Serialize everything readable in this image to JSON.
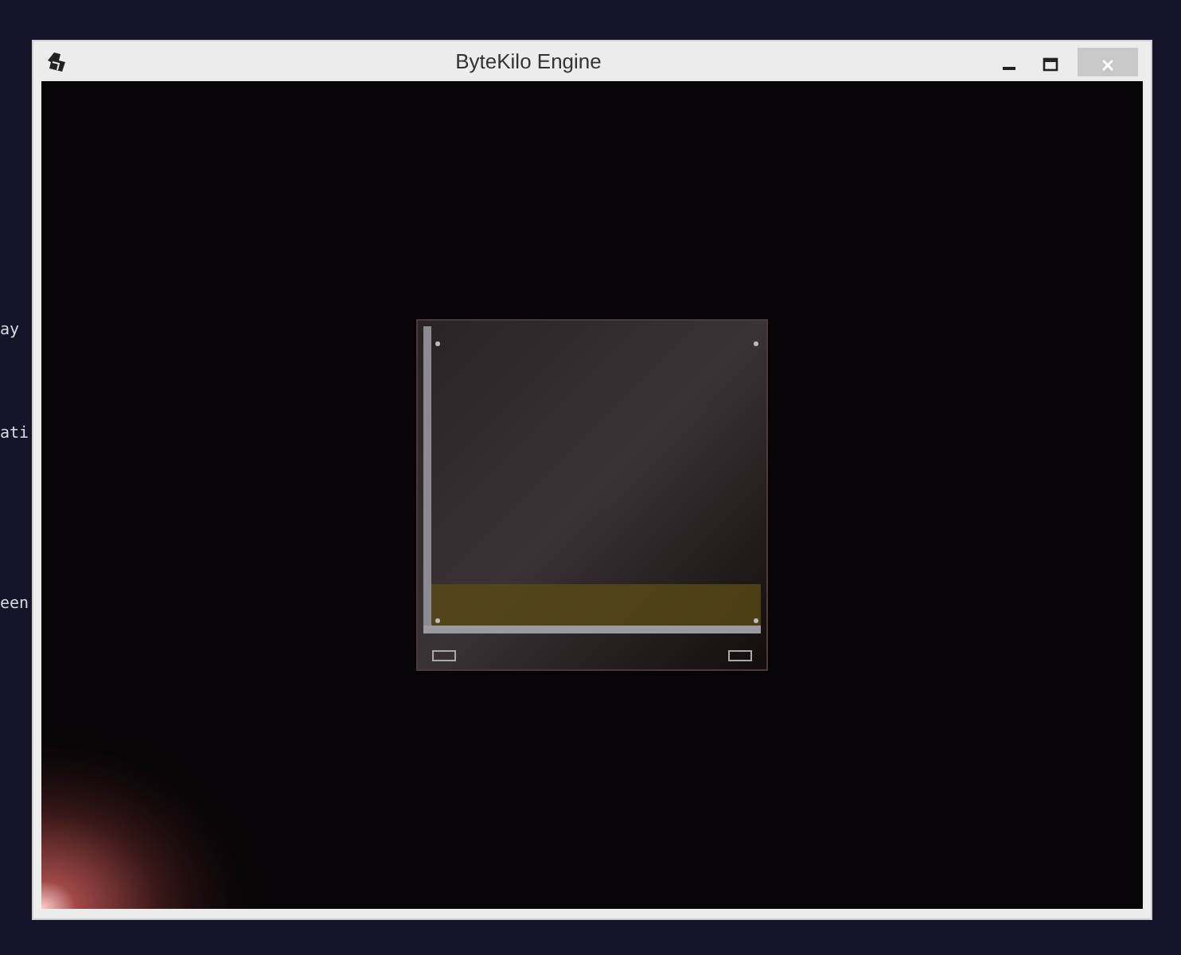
{
  "background_console": {
    "lines": [
      "ay",
      "ati",
      "een"
    ]
  },
  "window": {
    "title": "ByteKilo Engine"
  }
}
